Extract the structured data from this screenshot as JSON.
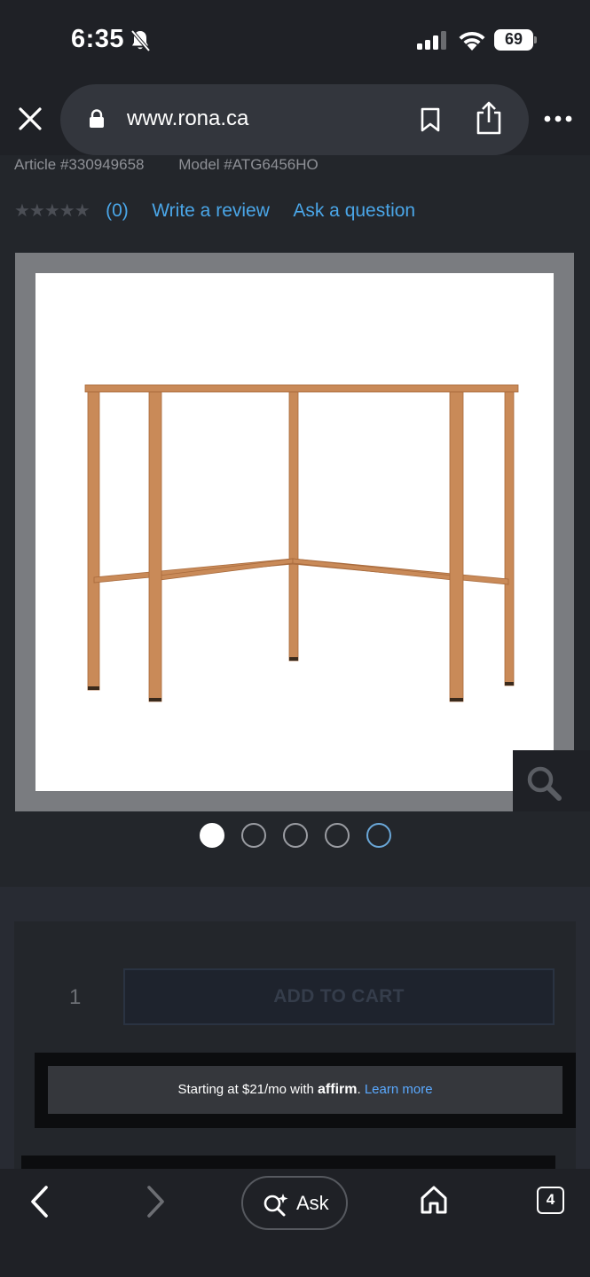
{
  "status_bar": {
    "time": "6:35",
    "battery": "69"
  },
  "browser": {
    "url": "www.rona.ca",
    "tab_count": "4",
    "ask_label": "Ask"
  },
  "product": {
    "article": "Article #330949658",
    "model": "Model #ATG6456HO",
    "rating_count": "(0)",
    "write_review": "Write a review",
    "ask_question": "Ask a question",
    "image_count": 5,
    "active_image": 1
  },
  "cart": {
    "quantity": "1",
    "add_to_cart": "ADD TO CART"
  },
  "affirm": {
    "prefix": "Starting at $21/mo with",
    "logo": "affirm",
    "suffix": ".",
    "learn_more": "Learn more"
  },
  "colors": {
    "link": "#4aa6e8",
    "background": "#23262b",
    "table_frame": "#c98a58"
  },
  "icons": [
    "bell-slash-icon",
    "signal-icon",
    "wifi-icon",
    "battery-icon",
    "close-icon",
    "lock-icon",
    "bookmark-icon",
    "share-icon",
    "more-icon",
    "zoom-icon",
    "chevron-left-icon",
    "chevron-right-icon",
    "ask-sparkle-icon",
    "home-icon",
    "tabs-icon"
  ]
}
